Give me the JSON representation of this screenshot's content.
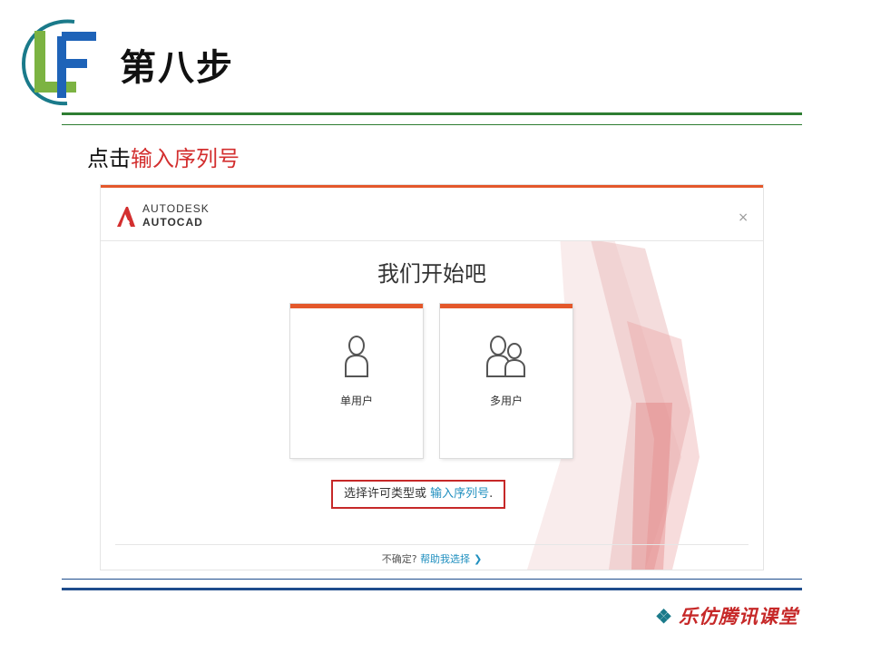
{
  "slide": {
    "title": "第八步",
    "instruction_prefix": "点击",
    "instruction_highlight": "输入序列号",
    "footer_brand": "乐仿腾讯课堂",
    "footer_icon": "❖",
    "colors": {
      "green_rule": "#2e7d32",
      "blue_rule": "#1e4c8c",
      "highlight": "#d32f2f"
    }
  },
  "dialog": {
    "brand_company": "AUTODESK",
    "brand_product": "AUTOCAD",
    "close_glyph": "×",
    "heading": "我们开始吧",
    "cards": [
      {
        "label": "单用户",
        "icon": "single-user-icon"
      },
      {
        "label": "多用户",
        "icon": "multi-user-icon"
      }
    ],
    "option_text": "选择许可类型或",
    "option_link": "输入序列号",
    "option_suffix": ".",
    "footer_text": "不确定?",
    "footer_link": "帮助我选择",
    "footer_chevron": "❯",
    "colors": {
      "accent": "#e4582b",
      "link": "#1f8fbf",
      "highlight_border": "#c62828"
    }
  }
}
